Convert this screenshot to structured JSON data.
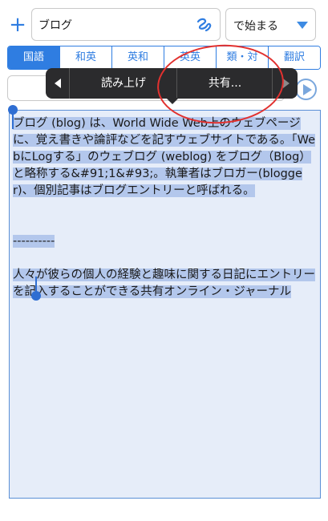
{
  "search": {
    "value": "ブログ",
    "icon": "handwriting-icon"
  },
  "mode": {
    "label": "で始まる"
  },
  "tabs": [
    {
      "label": "国語",
      "active": true
    },
    {
      "label": "和英",
      "active": false
    },
    {
      "label": "英和",
      "active": false
    },
    {
      "label": "英英",
      "active": false
    },
    {
      "label": "類・対",
      "active": false
    },
    {
      "label": "翻訳",
      "active": false
    }
  ],
  "context_menu": {
    "read_aloud": "読み上げ",
    "share": "共有..."
  },
  "content": {
    "text": "ブログ (blog) は、World Wide Web上のウェブページに、覚え書きや論評などを記すウェブサイトである。「WebにLogする」のウェブログ (weblog) をブログ（Blog）と略称する&#91;1&#93;。執筆者はブロガー(blogger)、個別記事はブログエントリーと呼ばれる。\n\n\n----------\n\n人々が彼らの個人の経験と趣味に関する日記にエントリーを記入することができる共有オンライン・ジャーナル"
  },
  "colors": {
    "accent": "#2f7de1",
    "selection": "#b3c7ec",
    "annotation": "#e2312f",
    "menu_bg": "#2b2b2d"
  }
}
